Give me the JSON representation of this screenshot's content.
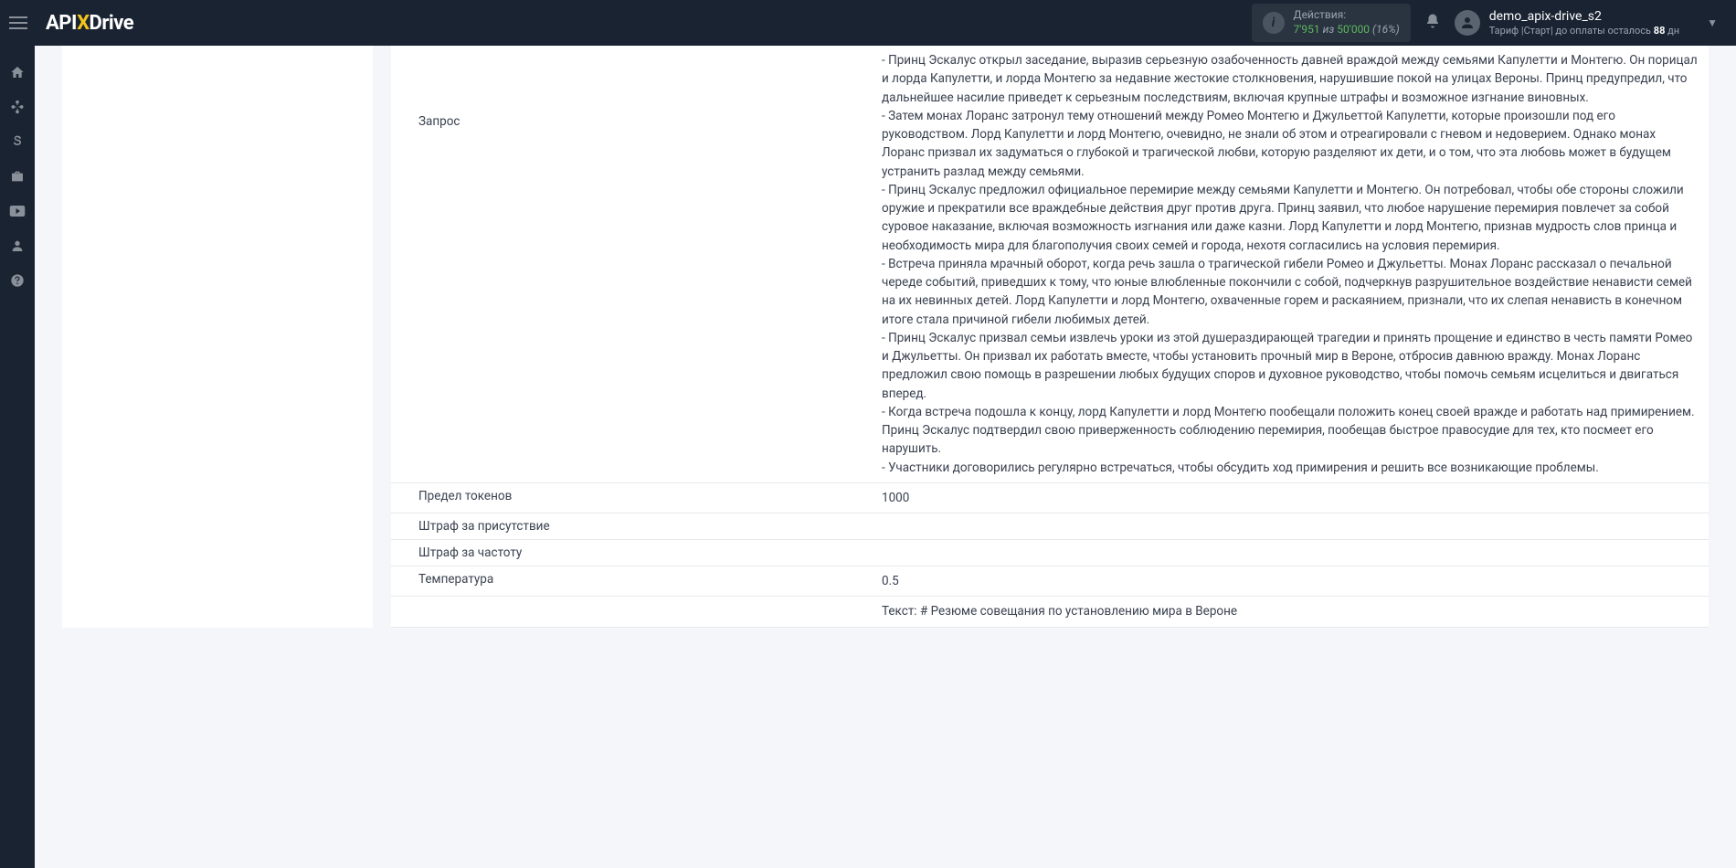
{
  "header": {
    "logo_pre": "API",
    "logo_x": "X",
    "logo_post": "Drive",
    "actions": {
      "label": "Действия:",
      "current": "7'951",
      "of": "из",
      "total": "50'000",
      "percent": "(16%)"
    },
    "user": {
      "name": "demo_apix-drive_s2",
      "tariff_prefix": "Тариф |Старт| до оплаты осталось",
      "days": "88",
      "days_suffix": "дн"
    }
  },
  "table": {
    "request": {
      "label": "Запрос",
      "paragraphs": [
        "- Принц Эскалус открыл заседание, выразив серьезную озабоченность давней враждой между семьями Капулетти и Монтегю. Он порицал и лорда Капулетти, и лорда Монтегю за недавние жестокие столкновения, нарушившие покой на улицах Вероны. Принц предупредил, что дальнейшее насилие приведет к серьезным последствиям, включая крупные штрафы и возможное изгнание виновных.",
        "- Затем монах Лоранс затронул тему отношений между Ромео Монтегю и Джульеттой Капулетти, которые произошли под его руководством. Лорд Капулетти и лорд Монтегю, очевидно, не знали об этом и отреагировали с гневом и недоверием. Однако монах Лоранс призвал их задуматься о глубокой и трагической любви, которую разделяют их дети, и о том, что эта любовь может в будущем устранить разлад между семьями.",
        "- Принц Эскалус предложил официальное перемирие между семьями Капулетти и Монтегю. Он потребовал, чтобы обе стороны сложили оружие и прекратили все враждебные действия друг против друга. Принц заявил, что любое нарушение перемирия повлечет за собой суровое наказание, включая возможность изгнания или даже казни. Лорд Капулетти и лорд Монтегю, признав мудрость слов принца и необходимость мира для благополучия своих семей и города, нехотя согласились на условия перемирия.",
        "- Встреча приняла мрачный оборот, когда речь зашла о трагической гибели Ромео и Джульетты. Монах Лоранс рассказал о печальной череде событий, приведших к тому, что юные влюбленные покончили с собой, подчеркнув разрушительное воздействие ненависти семей на их невинных детей. Лорд Капулетти и лорд Монтегю, охваченные горем и раскаянием, признали, что их слепая ненависть в конечном итоге стала причиной гибели любимых детей.",
        "- Принц Эскалус призвал семьи извлечь уроки из этой душераздирающей трагедии и принять прощение и единство в честь памяти Ромео и Джульетты. Он призвал их работать вместе, чтобы установить прочный мир в Вероне, отбросив давнюю вражду. Монах Лоранс предложил свою помощь в разрешении любых будущих споров и духовное руководство, чтобы помочь семьям исцелиться и двигаться вперед.",
        "- Когда встреча подошла к концу, лорд Капулетти и лорд Монтегю пообещали положить конец своей вражде и работать над примирением. Принц Эскалус подтвердил свою приверженность соблюдению перемирия, пообещав быстрое правосудие для тех, кто посмеет его нарушить.",
        "- Участники договорились регулярно встречаться, чтобы обсудить ход примирения и решить все возникающие проблемы."
      ]
    },
    "token_limit": {
      "label": "Предел токенов",
      "value": "1000"
    },
    "presence_penalty": {
      "label": "Штраф за присутствие",
      "value": ""
    },
    "frequency_penalty": {
      "label": "Штраф за частоту",
      "value": ""
    },
    "temperature": {
      "label": "Температура",
      "value": "0.5"
    },
    "text_output": {
      "label": "",
      "value": "Текст: # Резюме совещания по установлению мира в Вероне"
    }
  }
}
